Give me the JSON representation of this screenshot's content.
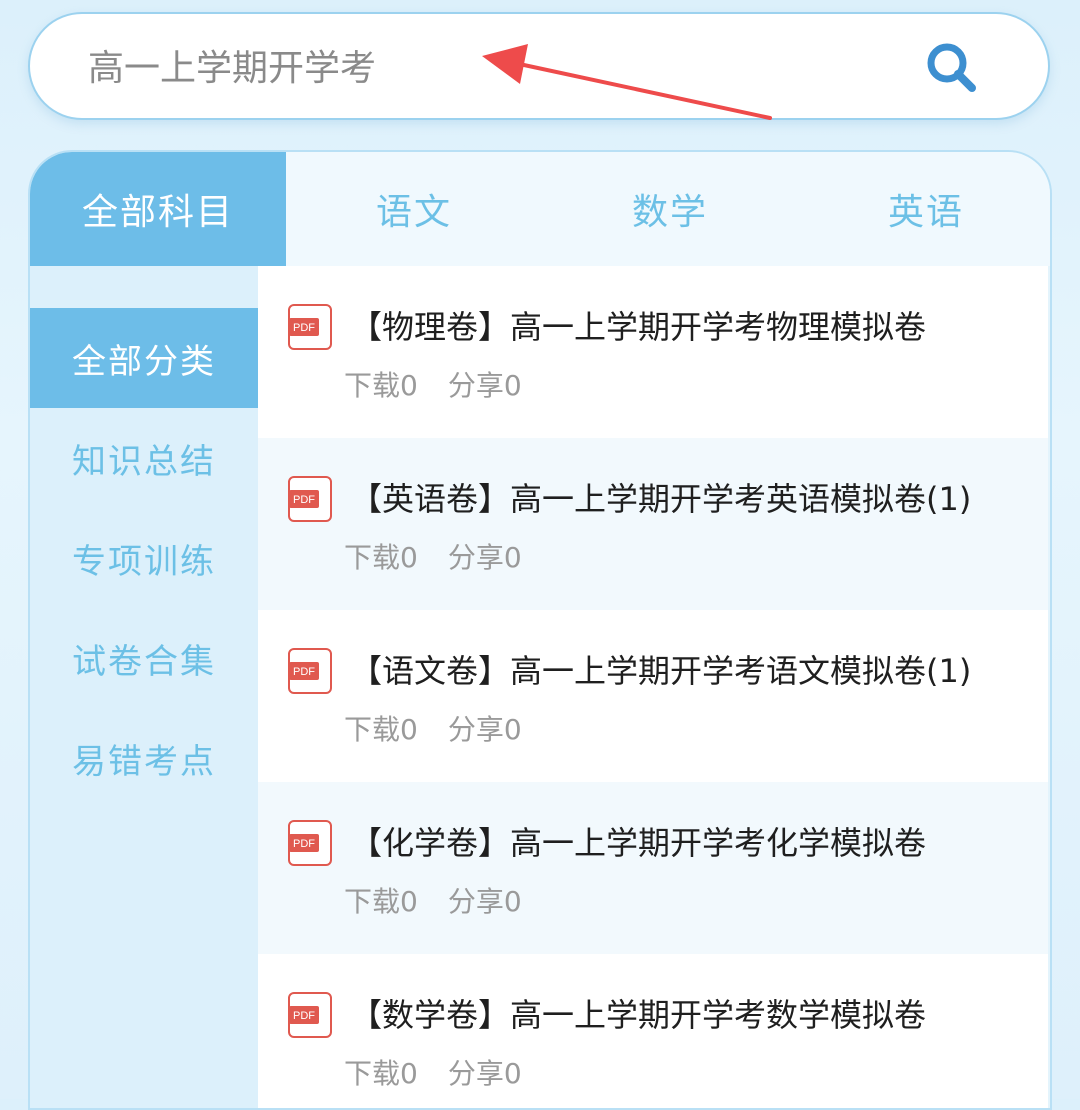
{
  "search": {
    "placeholder": "高一上学期开学考"
  },
  "subject_tabs": [
    {
      "label": "全部科目",
      "active": true
    },
    {
      "label": "语文",
      "active": false
    },
    {
      "label": "数学",
      "active": false
    },
    {
      "label": "英语",
      "active": false
    }
  ],
  "categories": [
    {
      "label": "全部分类",
      "active": true
    },
    {
      "label": "知识总结",
      "active": false
    },
    {
      "label": "专项训练",
      "active": false
    },
    {
      "label": "试卷合集",
      "active": false
    },
    {
      "label": "易错考点",
      "active": false
    }
  ],
  "files": [
    {
      "title": "【物理卷】高一上学期开学考物理模拟卷",
      "downloads": "下载0",
      "shares": "分享0"
    },
    {
      "title": "【英语卷】高一上学期开学考英语模拟卷(1)",
      "downloads": "下载0",
      "shares": "分享0"
    },
    {
      "title": "【语文卷】高一上学期开学考语文模拟卷(1)",
      "downloads": "下载0",
      "shares": "分享0"
    },
    {
      "title": "【化学卷】高一上学期开学考化学模拟卷",
      "downloads": "下载0",
      "shares": "分享0"
    },
    {
      "title": "【数学卷】高一上学期开学考数学模拟卷",
      "downloads": "下载0",
      "shares": "分享0"
    }
  ],
  "icons": {
    "file": "pdf-icon",
    "search": "search-icon",
    "annotation": "red-arrow-icon"
  },
  "colors": {
    "accent": "#6dbde8",
    "tab_text": "#6cc0e6",
    "pdf": "#e0594f",
    "arrow": "#ee4b4b"
  }
}
